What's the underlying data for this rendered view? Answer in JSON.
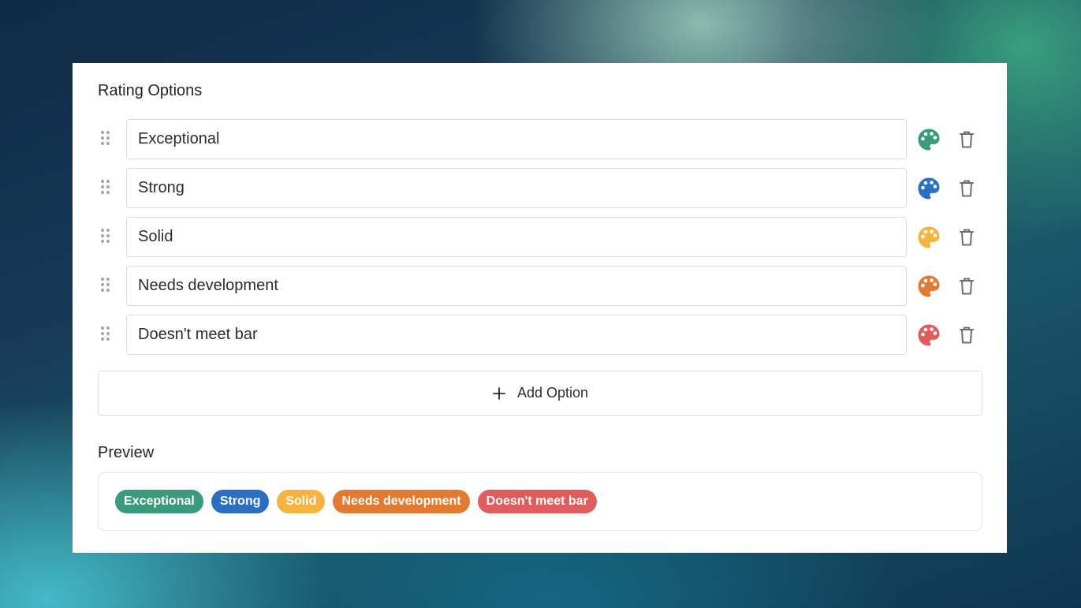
{
  "section_titles": {
    "rating_options": "Rating Options",
    "preview": "Preview"
  },
  "options": [
    {
      "label": "Exceptional",
      "color": "#3a9a7b",
      "icons": [
        "drag-handle-icon",
        "palette-icon",
        "trash-icon"
      ]
    },
    {
      "label": "Strong",
      "color": "#2b6fc2",
      "icons": [
        "drag-handle-icon",
        "palette-icon",
        "trash-icon"
      ]
    },
    {
      "label": "Solid",
      "color": "#f4b43f",
      "icons": [
        "drag-handle-icon",
        "palette-icon",
        "trash-icon"
      ]
    },
    {
      "label": "Needs development",
      "color": "#e27a32",
      "icons": [
        "drag-handle-icon",
        "palette-icon",
        "trash-icon"
      ]
    },
    {
      "label": "Doesn't meet bar",
      "color": "#e05d5d",
      "icons": [
        "drag-handle-icon",
        "palette-icon",
        "trash-icon"
      ]
    }
  ],
  "add_option": {
    "label": "Add Option",
    "icon": "plus-icon"
  },
  "preview_chips": [
    {
      "label": "Exceptional",
      "color": "#3a9a7b"
    },
    {
      "label": "Strong",
      "color": "#2b6fc2"
    },
    {
      "label": "Solid",
      "color": "#f4b43f"
    },
    {
      "label": "Needs development",
      "color": "#e27a32"
    },
    {
      "label": "Doesn't meet bar",
      "color": "#e05d5d"
    }
  ],
  "colors": {
    "trash_icon": "#6b6e73",
    "drag_handle": "#a3a6ab",
    "text": "#2a2c30",
    "border": "#d9dbde"
  }
}
